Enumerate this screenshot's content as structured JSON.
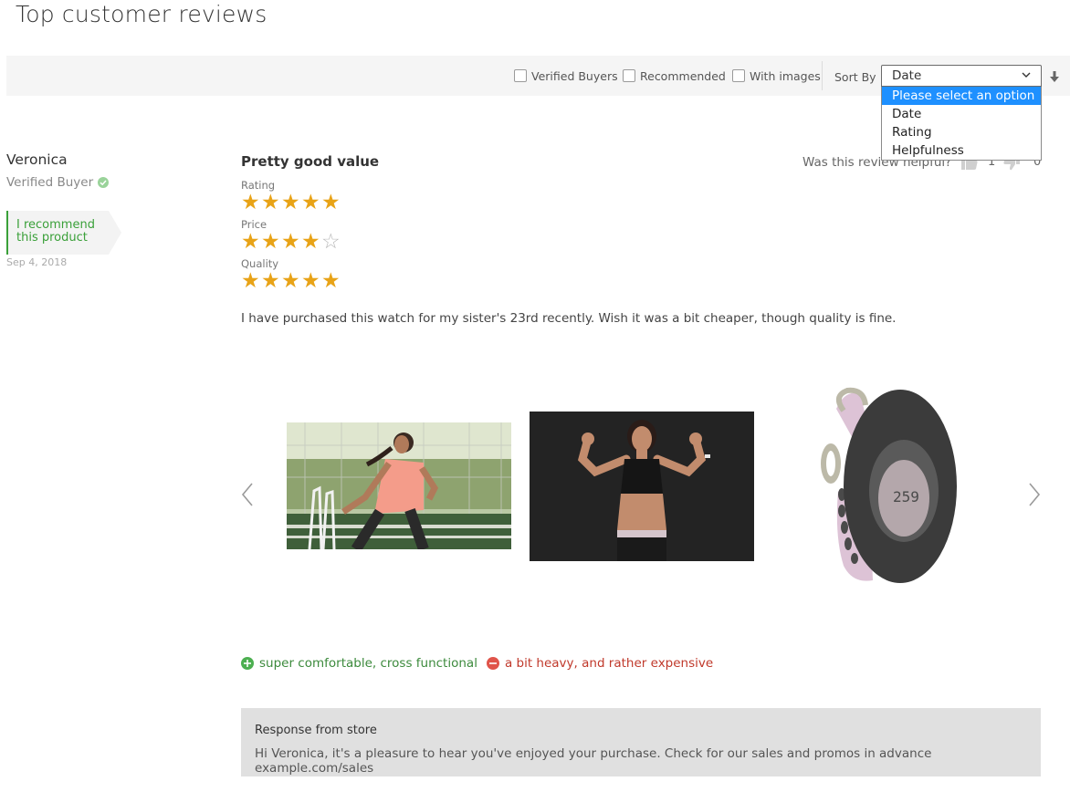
{
  "page": {
    "title": "Top customer reviews"
  },
  "toolbar": {
    "filters": [
      {
        "label": "Verified Buyers",
        "checked": false
      },
      {
        "label": "Recommended",
        "checked": false
      },
      {
        "label": "With images",
        "checked": false
      }
    ],
    "sort_label": "Sort By",
    "sort_value": "Date",
    "sort_options": [
      "Please select an option",
      "Date",
      "Rating",
      "Helpfulness"
    ],
    "sort_highlighted": "Please select an option",
    "sort_direction_icon": "arrow-down-icon"
  },
  "review": {
    "reviewer": "Veronica",
    "verified_label": "Verified Buyer",
    "recommend_label_line1": "I recommend",
    "recommend_label_line2": "this product",
    "date": "Sep 4, 2018",
    "title": "Pretty good value",
    "helpful_question": "Was this review helpful?",
    "helpful_yes_count": "1",
    "helpful_no_count": "0",
    "ratings": [
      {
        "label": "Rating",
        "value": 5,
        "max": 5
      },
      {
        "label": "Price",
        "value": 4,
        "max": 5
      },
      {
        "label": "Quality",
        "value": 5,
        "max": 5
      }
    ],
    "text": "I have purchased this watch for my sister's 23rd recently. Wish it was a bit cheaper, though quality is fine.",
    "pros": "super comfortable, cross functional",
    "cons": "a bit heavy, and rather expensive"
  },
  "store_response": {
    "title": "Response from store",
    "message": "Hi Veronica, it's a pleasure to hear you've enjoyed your purchase. Check for our sales and promos in advance example.com/sales"
  },
  "colors": {
    "star": "#e8a317",
    "recommend_green": "#3aa039",
    "pros_green": "#3c8a3c",
    "cons_red": "#c0392b",
    "dropdown_highlight": "#1e90ff"
  }
}
